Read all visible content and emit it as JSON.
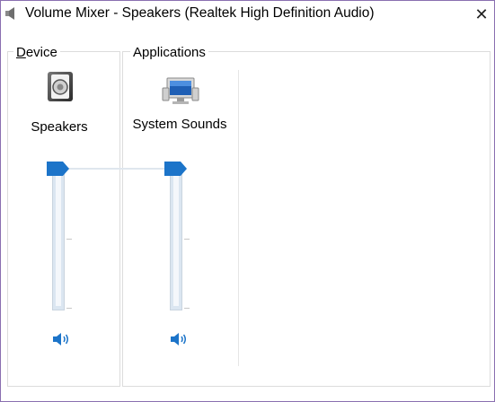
{
  "window": {
    "title": "Volume Mixer - Speakers (Realtek High Definition Audio)",
    "close_label": "✕"
  },
  "device": {
    "group_label_first": "D",
    "group_label_rest": "evice",
    "name": "Speakers",
    "icon": "speaker-icon",
    "volume_percent": 100,
    "mute_icon": "volume-icon"
  },
  "applications": {
    "group_label": "Applications",
    "items": [
      {
        "name": "System Sounds",
        "icon": "system-sounds-icon",
        "volume_percent": 100,
        "mute_icon": "volume-icon"
      }
    ]
  },
  "colors": {
    "accent": "#1c74c9",
    "frame": "#8a6fb0"
  }
}
